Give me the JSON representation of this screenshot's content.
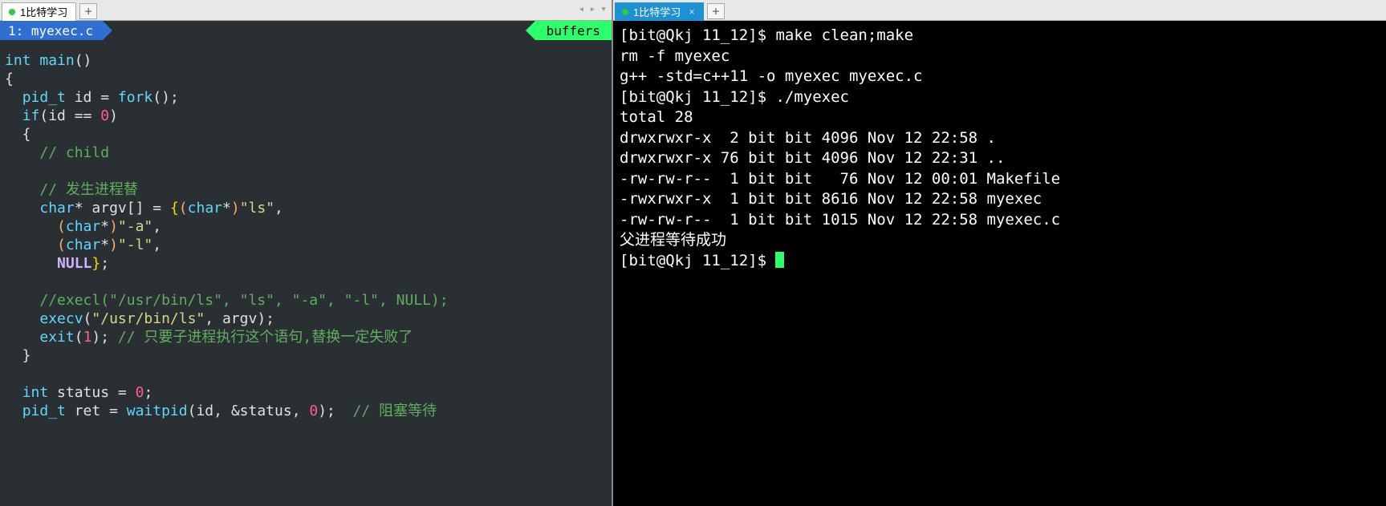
{
  "tabs": {
    "left": {
      "label": "1比特学习"
    },
    "right": {
      "label": "1比特学习"
    },
    "plus": "+",
    "nav_left": "◂",
    "nav_right": "▸",
    "nav_down": "▾"
  },
  "bufferline": {
    "file_label": "1: myexec.c",
    "right_label": "buffers"
  },
  "code": {
    "l1_int": "int",
    "l1_main": "main",
    "l3_pidt": "pid_t",
    "l3_id": "id",
    "l3_fork": "fork",
    "l4_if": "if",
    "l4_id": "id",
    "l4_zero": "0",
    "l6_cmt": "// child",
    "l8_cmt": "// 发生进程替",
    "l9_char": "char",
    "l9_argv": "argv",
    "l9_chars": "char",
    "l9_str": "\"ls\"",
    "l10_chars": "char",
    "l10_str": "\"-a\"",
    "l11_chars": "char",
    "l11_str": "\"-l\"",
    "l12_null": "NULL",
    "l14_cmt": "//execl(\"/usr/bin/ls\", \"ls\", \"-a\", \"-l\", NULL);",
    "l15_execv": "execv",
    "l15_path": "\"/usr/bin/ls\"",
    "l15_argv": "argv",
    "l16_exit": "exit",
    "l16_one": "1",
    "l16_cmt": "// 只要子进程执行这个语句,替换一定失败了",
    "l19_int": "int",
    "l19_status": "status",
    "l19_zero": "0",
    "l20_pidt": "pid_t",
    "l20_ret": "ret",
    "l20_wait": "waitpid",
    "l20_id": "id",
    "l20_status": "status",
    "l20_zero": "0",
    "l20_cmt": "// 阻塞等待"
  },
  "terminal": {
    "l1": "[bit@Qkj 11_12]$ make clean;make",
    "l2": "rm -f myexec",
    "l3": "g++ -std=c++11 -o myexec myexec.c",
    "l4": "[bit@Qkj 11_12]$ ./myexec",
    "l5": "total 28",
    "l6": "drwxrwxr-x  2 bit bit 4096 Nov 12 22:58 .",
    "l7": "drwxrwxr-x 76 bit bit 4096 Nov 12 22:31 ..",
    "l8": "-rw-rw-r--  1 bit bit   76 Nov 12 00:01 Makefile",
    "l9": "-rwxrwxr-x  1 bit bit 8616 Nov 12 22:58 myexec",
    "l10": "-rw-rw-r--  1 bit bit 1015 Nov 12 22:58 myexec.c",
    "l11": "父进程等待成功",
    "l12": "[bit@Qkj 11_12]$ "
  }
}
